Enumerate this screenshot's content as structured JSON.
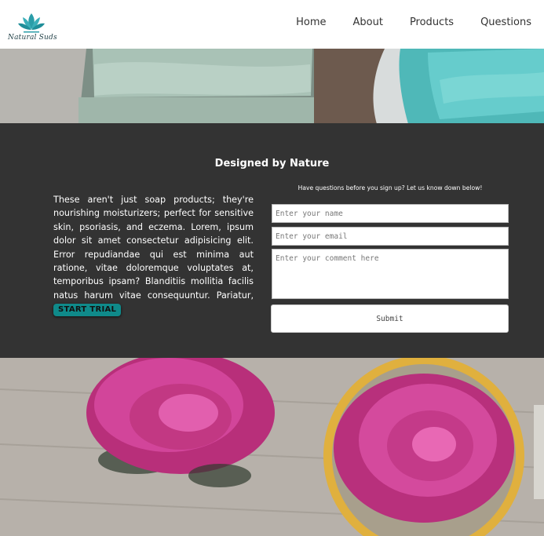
{
  "header": {
    "logo_text": "Natural Suds",
    "nav": [
      "Home",
      "About",
      "Products",
      "Questions"
    ]
  },
  "main": {
    "title": "Designed by Nature",
    "intro": "These aren't just soap products; they're nourishing moisturizers; perfect for sensitive skin, psoriasis, and eczema. Lorem, ipsum dolor sit amet consectetur adipisicing elit. Error repudiandae qui est minima aut ratione, vitae doloremque voluptates at, temporibus ipsam? Blanditiis mollitia facilis natus harum vitae consequuntur. Pariatur, possimus.",
    "trial_button": "START TRIAL"
  },
  "form": {
    "note": "Have questions before you sign up? Let us know down below!",
    "name_placeholder": "Enter your name",
    "email_placeholder": "Enter your email",
    "comment_placeholder": "Enter your comment here",
    "submit_label": "Submit"
  },
  "colors": {
    "dark_section": "#333333",
    "accent_teal": "#0f8a8a",
    "logo_teal": "#2a9da8"
  }
}
